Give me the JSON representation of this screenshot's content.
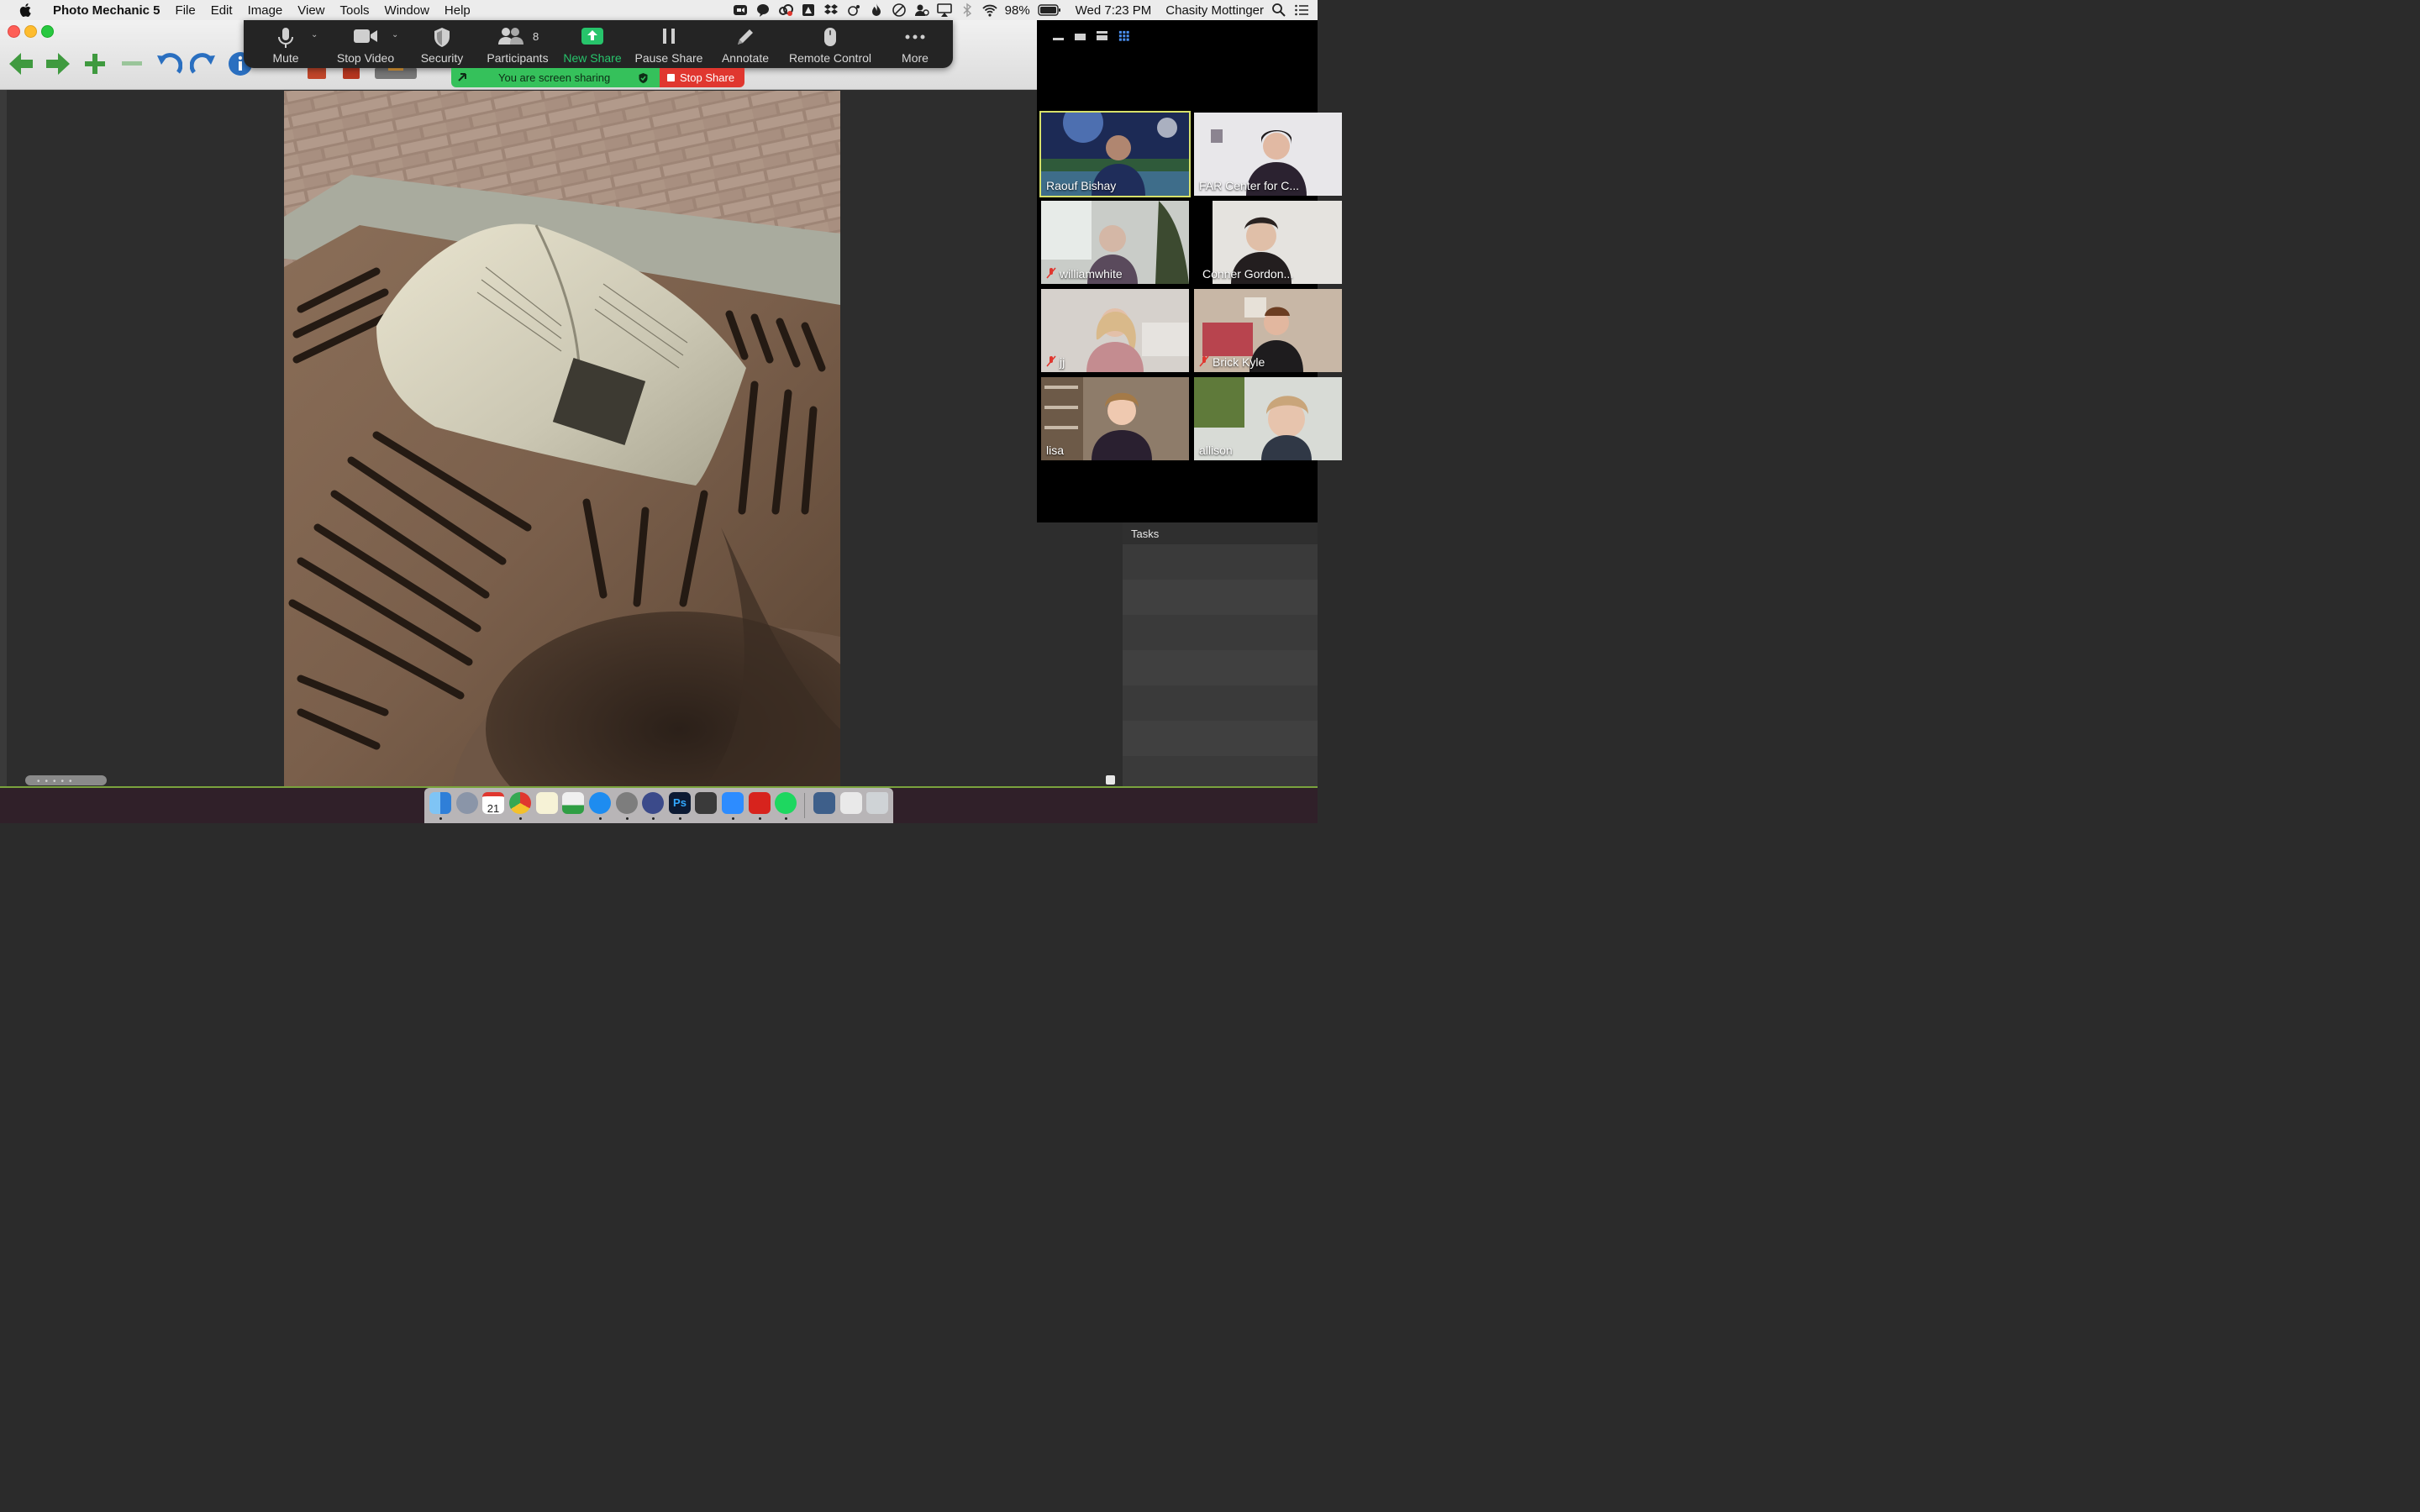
{
  "menubar": {
    "app_name": "Photo Mechanic 5",
    "menus": [
      "File",
      "Edit",
      "Image",
      "View",
      "Tools",
      "Window",
      "Help"
    ],
    "battery": "98%",
    "clock": "Wed 7:23 PM",
    "user": "Chasity Mottinger"
  },
  "zoom_toolbar": {
    "mute": "Mute",
    "stop_video": "Stop Video",
    "security": "Security",
    "participants": "Participants",
    "participants_count": "8",
    "new_share": "New Share",
    "pause_share": "Pause Share",
    "annotate": "Annotate",
    "remote_control": "Remote Control",
    "more": "More"
  },
  "share_bar": {
    "status": "You are screen sharing",
    "stop": "Stop Share"
  },
  "gallery": {
    "participants": [
      {
        "name": "Raouf Bishay",
        "muted": false,
        "active": true
      },
      {
        "name": "FAR Center for C...",
        "muted": false,
        "active": false
      },
      {
        "name": "williamwhite",
        "muted": true,
        "active": false
      },
      {
        "name": "Conner Gordon...",
        "muted": false,
        "active": false
      },
      {
        "name": "jj",
        "muted": true,
        "active": false
      },
      {
        "name": "Brick Kyle",
        "muted": true,
        "active": false
      },
      {
        "name": "lisa",
        "muted": false,
        "active": false
      },
      {
        "name": "allison",
        "muted": false,
        "active": false
      }
    ]
  },
  "tasks_panel": {
    "title": "Tasks"
  },
  "colors": {
    "zoom_green": "#27c46b",
    "share_green": "#35c15b",
    "stop_red": "#e0372f",
    "active_speaker": "#d6e06a",
    "pm_green": "#3f9a3f",
    "pm_blue": "#2a6fc0"
  },
  "dock": {
    "apps": [
      "finder-icon",
      "launchpad-icon",
      "calendar-icon",
      "chrome-icon",
      "notes-icon",
      "numbers-icon",
      "app-store-icon",
      "system-preferences-icon",
      "photo-mechanic-icon",
      "photoshop-icon",
      "screen-capture-icon",
      "zoom-icon",
      "acrobat-icon",
      "spotify-icon",
      "preview-icon",
      "files-icon",
      "trash-icon"
    ],
    "calendar_day": "21",
    "photoshop_label": "Ps"
  }
}
